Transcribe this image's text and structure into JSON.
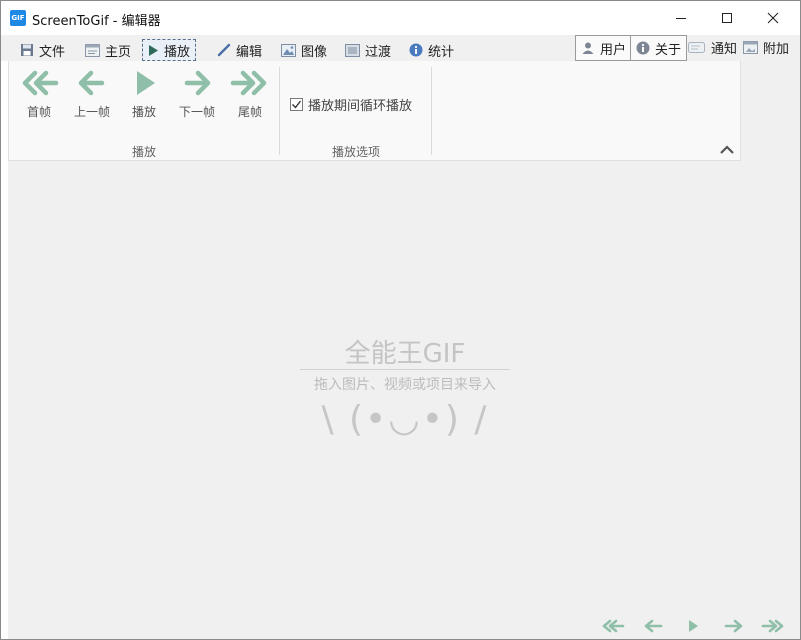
{
  "window": {
    "app_icon_text": "GIF",
    "title": "ScreenToGif - 编辑器"
  },
  "tabs": [
    {
      "label": "文件",
      "icon": "floppy-icon"
    },
    {
      "label": "主页",
      "icon": "home-page-icon"
    },
    {
      "label": "播放",
      "icon": "play-icon",
      "selected": true
    },
    {
      "label": "编辑",
      "icon": "pencil-icon"
    },
    {
      "label": "图像",
      "icon": "image-icon"
    },
    {
      "label": "过渡",
      "icon": "transition-icon"
    },
    {
      "label": "统计",
      "icon": "info-icon"
    }
  ],
  "right_tabs": [
    {
      "label": "用户",
      "icon": "user-icon"
    },
    {
      "label": "关于",
      "icon": "info-icon"
    },
    {
      "label": "通知",
      "icon": "notification-icon"
    },
    {
      "label": "附加",
      "icon": "extras-icon"
    }
  ],
  "ribbon": {
    "playback_group": {
      "label": "播放",
      "buttons": [
        {
          "label": "首帧",
          "icon": "double-arrow-left-icon"
        },
        {
          "label": "上一帧",
          "icon": "arrow-left-icon"
        },
        {
          "label": "播放",
          "icon": "play-triangle-icon"
        },
        {
          "label": "下一帧",
          "icon": "arrow-right-icon"
        },
        {
          "label": "尾帧",
          "icon": "double-arrow-right-icon"
        }
      ]
    },
    "options_group": {
      "label": "播放选项",
      "loop_checkbox": {
        "label": "播放期间循环播放",
        "checked": true
      }
    }
  },
  "empty_state": {
    "title": "全能王GIF",
    "subtitle": "拖入图片、视频或项目来导入",
    "face": "\\ (•◡•) /"
  },
  "colors": {
    "nav_arrow": "#8fbfa8",
    "accent_blue": "#1e88e5",
    "canvas_bg": "#f0f0f0"
  }
}
